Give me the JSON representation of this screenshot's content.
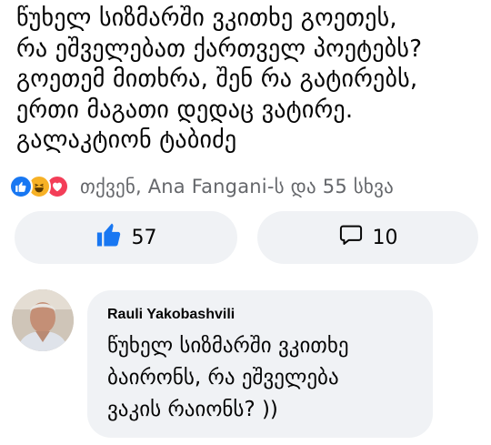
{
  "post": {
    "lines": [
      "წუხელ სიზმარში ვკითხე გოეთეს,",
      "რა ეშველებათ ქართველ პოეტებს?",
      "გოეთემ მითხრა, შენ რა გატირებს,",
      "ერთი მაგათი დედაც ვატირე.",
      "გალაკტიონ ტაბიძე"
    ]
  },
  "reactions": {
    "icons": [
      "like-icon",
      "haha-icon",
      "love-icon"
    ],
    "summary": "თქვენ, Ana Fangani-ს და 55 სხვა"
  },
  "actions": {
    "like_count": "57",
    "comment_count": "10"
  },
  "comment": {
    "author": "Rauli Yakobashvili",
    "lines": [
      "წუხელ სიზმარში ვკითხე",
      "ბაირონს, რა ეშველება",
      "ვაკის რაიონს? ))"
    ]
  },
  "colors": {
    "like_blue": "#1877f2",
    "haha_yellow": "#f7b125",
    "love_red": "#f33e58",
    "secondary_text": "#65676b",
    "bubble_bg": "#f0f2f5"
  }
}
